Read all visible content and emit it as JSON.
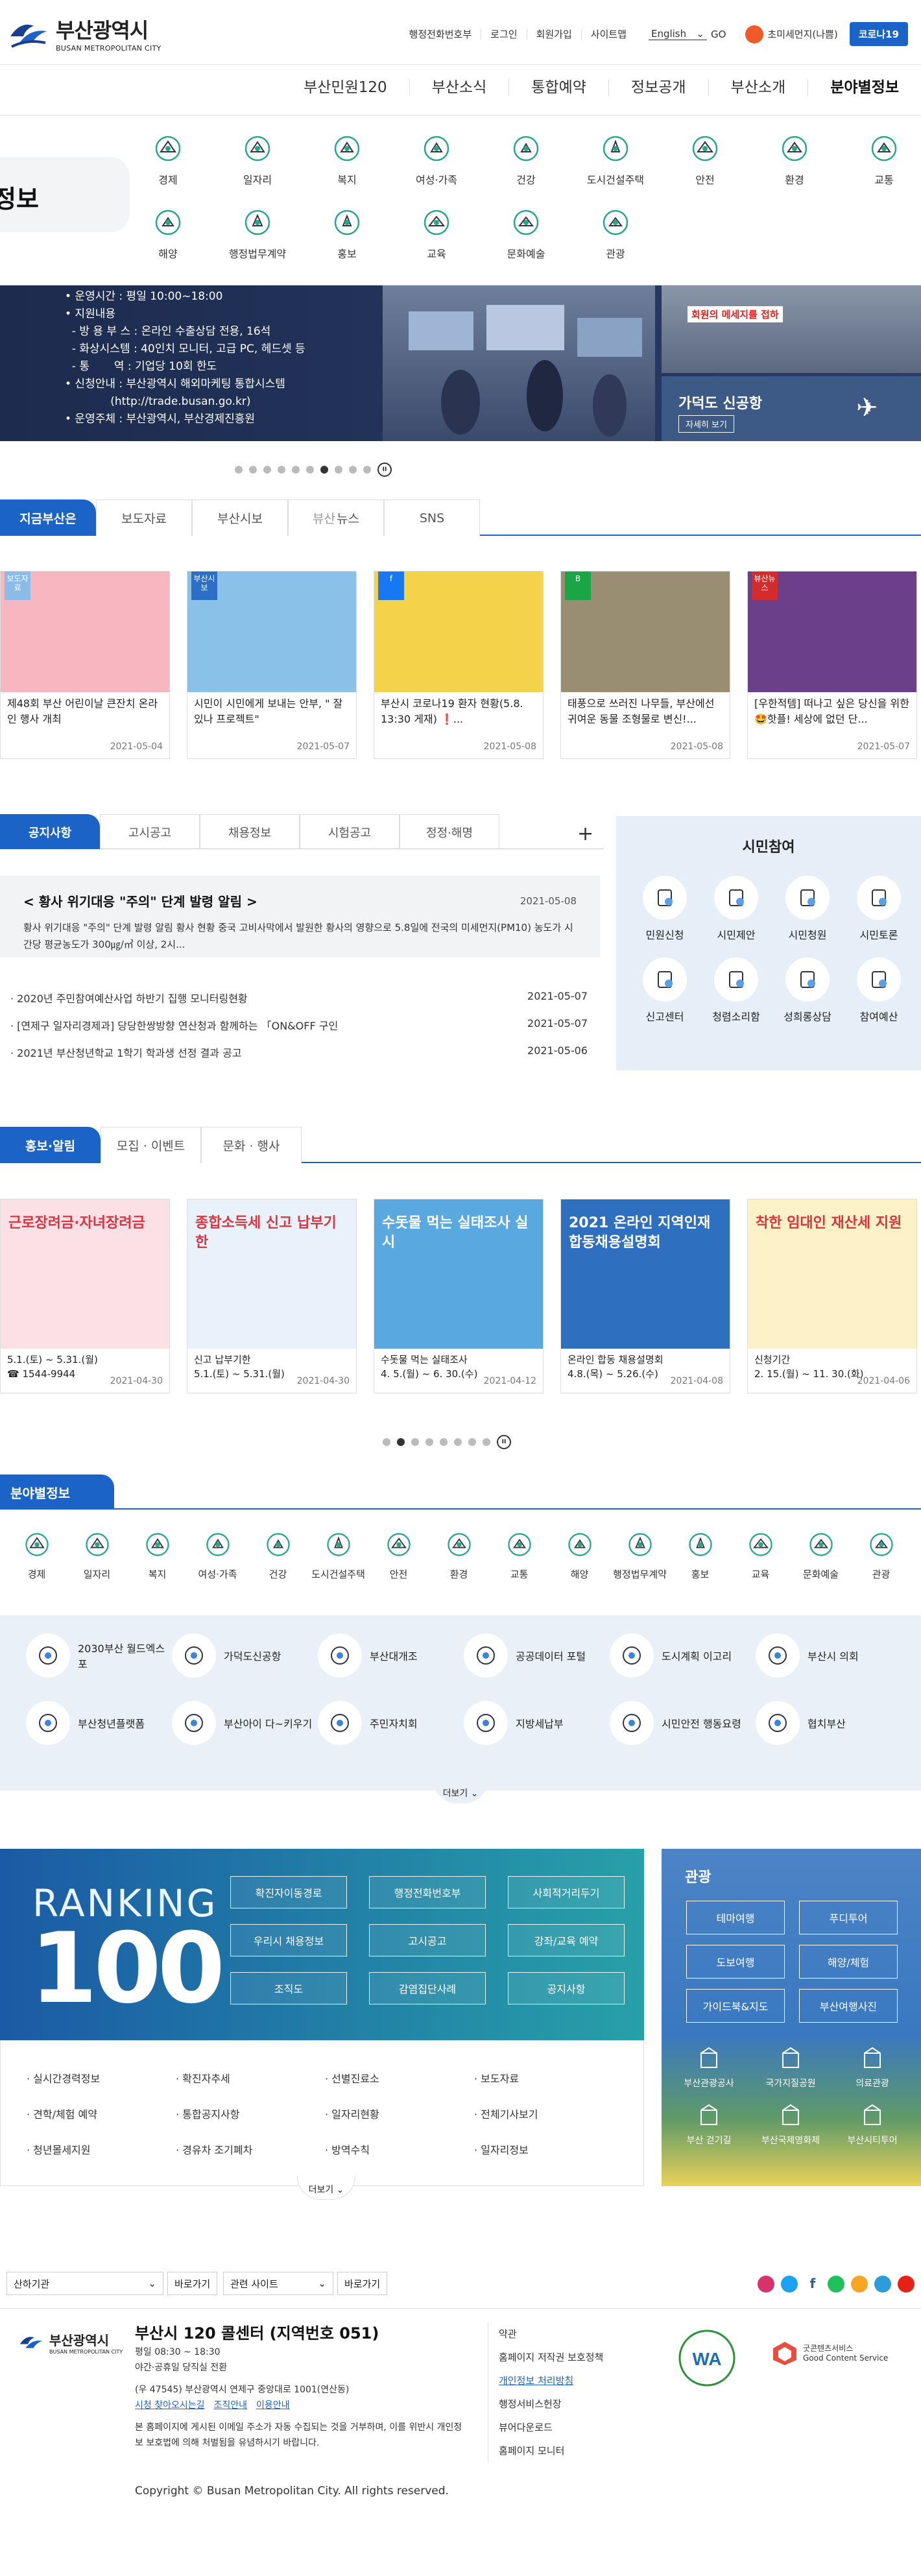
{
  "header": {
    "logo_ko": "부산광역시",
    "logo_en": "BUSAN METROPOLITAN CITY",
    "util_links": [
      "행정전화번호부",
      "로그인",
      "회원가입",
      "사이트맵"
    ],
    "language": "English",
    "go": "GO",
    "cyber": "초미세먼지(나쁨)",
    "covid_button": "코로나19"
  },
  "gnb": [
    "부산민원120",
    "부산소식",
    "통합예약",
    "정보공개",
    "부산소개",
    "분야별정보"
  ],
  "field_dropdown": {
    "left_label": "정보",
    "items": [
      "경제",
      "일자리",
      "복지",
      "여성·가족",
      "건강",
      "도시건설주택",
      "안전",
      "환경",
      "교통",
      "해양",
      "행정법무계약",
      "홍보",
      "교육",
      "문화예술",
      "관광"
    ]
  },
  "slider": {
    "lines": [
      "• 운영시간 : 평일 10:00~18:00",
      "• 지원내용",
      "  - 방 용 부 스 : 온라인 수출상담 전용, 16석",
      "  - 화상시스템 : 40인치 모니터, 고급 PC, 헤드셋 등",
      "  - 통       역 : 기업당 10회 한도",
      "• 신청안내 : 부산광역시 해외마케팅 통합시스템",
      "             (http://trade.busan.go.kr)",
      "• 운영주체 : 부산광역시, 부산경제진흥원"
    ],
    "side_top_text": "회원의 메세지를 접하",
    "side_title": "가덕도 신공항",
    "side_button": "자세히 보기"
  },
  "news_tabs": [
    "지금부산은",
    "보도자료",
    "부산시보",
    "뉴스",
    "SNS"
  ],
  "news_cards": [
    {
      "badge": "보도자료",
      "caption": "제48회 부산 어린이날 큰잔치 온라인 행사 개최",
      "date": "2021-05-04",
      "color": "#f7b6c0"
    },
    {
      "badge": "부산시보",
      "caption": "시민이 시민에게 보내는 안부, \" 잘 있나 프로젝트\"",
      "date": "2021-05-07",
      "color": "#8ac1e8"
    },
    {
      "badge": "f",
      "caption": "부산시 코로나19 환자 현황(5.8. 13:30 게재) ❗...",
      "date": "2021-05-08",
      "color": "#f4d34a"
    },
    {
      "badge": "B",
      "caption": "태풍으로 쓰러진 나무들, 부산에선 귀여운 동물 조형물로 변신!...",
      "date": "2021-05-08",
      "color": "#9a8e72"
    },
    {
      "badge": "뷰산뉴스",
      "caption": "[우한적템] 떠나고 싶은 당신을 위한🤩핫플! 세상에 없던 단...",
      "date": "2021-05-07",
      "color": "#6b3f8a"
    }
  ],
  "notice": {
    "tabs": [
      "공지사항",
      "고시공고",
      "채용정보",
      "시험공고",
      "정정·해명"
    ],
    "featured_title": "< 황사 위기대응 \"주의\" 단계 발령 알림 >",
    "featured_date": "2021-05-08",
    "featured_desc": "황사 위기대응 \"주의\" 단계 발령 알림 황사 현황 중국 고비사막에서 발원한 황사의 영향으로 5.8일에 전국의 미세먼지(PM10) 농도가 시간당 평균농도가 300㎍/㎥ 이상, 2시...",
    "items": [
      {
        "title": "2020년 주민참여예산사업 하반기 집행 모니터링현황",
        "date": "2021-05-07"
      },
      {
        "title": "[연제구 일자리경제과] 당당한쌍방향 연산청과 함께하는 「ON&OFF 구인",
        "date": "2021-05-07"
      },
      {
        "title": "2021년 부산청년학교 1학기 학과생 선정 결과 공고",
        "date": "2021-05-06"
      }
    ]
  },
  "citizen": {
    "title": "시민참여",
    "items": [
      "민원신청",
      "시민제안",
      "시민청원",
      "시민토론",
      "신고센터",
      "청렴소리함",
      "성희롱상담",
      "참여예산"
    ]
  },
  "promo_tabs": [
    "홍보·알림",
    "모집 · 이벤트",
    "문화 · 행사"
  ],
  "promo_cards": [
    {
      "img_text": "근로장려금·자녀장려금",
      "caption": "5.1.(토) ~ 5.31.(월)\n☎ 1544-9944",
      "date": "2021-04-30",
      "color": "#fbe1e6"
    },
    {
      "img_text": "종합소득세 신고 납부기한",
      "caption": "신고 납부기한\n5.1.(토) ~ 5.31.(월)",
      "date": "2021-04-30",
      "color": "#e9f1fa"
    },
    {
      "img_text": "수돗물 먹는 실태조사 실시",
      "caption": "수돗물 먹는 실태조사\n4. 5.(월) ~ 6. 30.(수)",
      "date": "2021-04-12",
      "color": "#5aa8e0"
    },
    {
      "img_text": "2021 온라인 지역인재 합동채용설명회",
      "caption": "온라인 합동 채용설명회\n4.8.(목) ~ 5.26.(수)",
      "date": "2021-04-08",
      "color": "#2f6fc0"
    },
    {
      "img_text": "착한 임대인 재산세 지원",
      "caption": "신청기간\n2. 15.(월) ~ 11. 30.(화)",
      "date": "2021-04-06",
      "color": "#fdf1c8"
    }
  ],
  "field_section": {
    "title": "분야별정보",
    "items": [
      "경제",
      "일자리",
      "복지",
      "여성·가족",
      "건강",
      "도시건설주택",
      "안전",
      "환경",
      "교통",
      "해양",
      "행정법무계약",
      "홍보",
      "교육",
      "문화예술",
      "관광"
    ],
    "related": [
      "2030부산 월드엑스포",
      "가덕도신공항",
      "부산대개조",
      "공공데이터 포털",
      "도시계획 이고리",
      "부산시 의회",
      "부산청년플랫폼",
      "부산아이 다~키우기",
      "주민자치회",
      "지방세납부",
      "시민안전 행동요령",
      "협치부산"
    ],
    "more": "더보기"
  },
  "ranking": {
    "big1": "RANKING",
    "big2": "100",
    "buttons": [
      "확진자이동경로",
      "행정전화번호부",
      "사회적거리두기",
      "우리시 채용정보",
      "고시공고",
      "강좌/교육 예약",
      "조직도",
      "감염집단사례",
      "공지사항"
    ],
    "list": [
      "실시간경력정보",
      "확진자추세",
      "선별진료소",
      "보도자료",
      "견학/체험 예약",
      "통합공지사항",
      "일자리현황",
      "전체기사보기",
      "청년몰세지원",
      "경유차 조기폐차",
      "방역수칙",
      "일자리정보"
    ],
    "more": "더보기"
  },
  "tour": {
    "title": "관광",
    "buttons": [
      "테마여행",
      "푸디투어",
      "도보여행",
      "해양/체험",
      "가이드북&지도",
      "부산여행사진"
    ],
    "icons": [
      "부산관광공사",
      "국가지질공원",
      "의료관광",
      "부산 걷기길",
      "부산국제영화제",
      "부산시티투어"
    ]
  },
  "footer": {
    "select1": "산하기관",
    "select2": "관련 사이트",
    "go": "바로가기",
    "center_title": "부산시 120 콜센터 (지역번호 051)",
    "hours1": "평일 08:30 ~ 18:30",
    "hours2": "야간·공휴일 당직실 전환",
    "address": "(우 47545) 부산광역시 연제구 중앙대로 1001(연산동)",
    "links_inline": [
      "시청 찾아오시는길",
      "조직안내",
      "이용안내"
    ],
    "notice_text": "본 홈페이지에 게시된 이메일 주소가 자동 수집되는 것을 거부하며, 이를 위반시 개인정보 보호법에 의해 처벌됨을 유념하시기 바랍니다.",
    "copyright": "Copyright © Busan Metropolitan City. All rights reserved.",
    "links": [
      "약관",
      "홈페이지 저작권 보호정책",
      "개인정보 처리방침",
      "행정서비스헌장",
      "뷰어다운로드",
      "홈페이지 모니터"
    ],
    "gcs": "굿콘텐츠서비스\nGood Content Service",
    "wa": "WA"
  }
}
